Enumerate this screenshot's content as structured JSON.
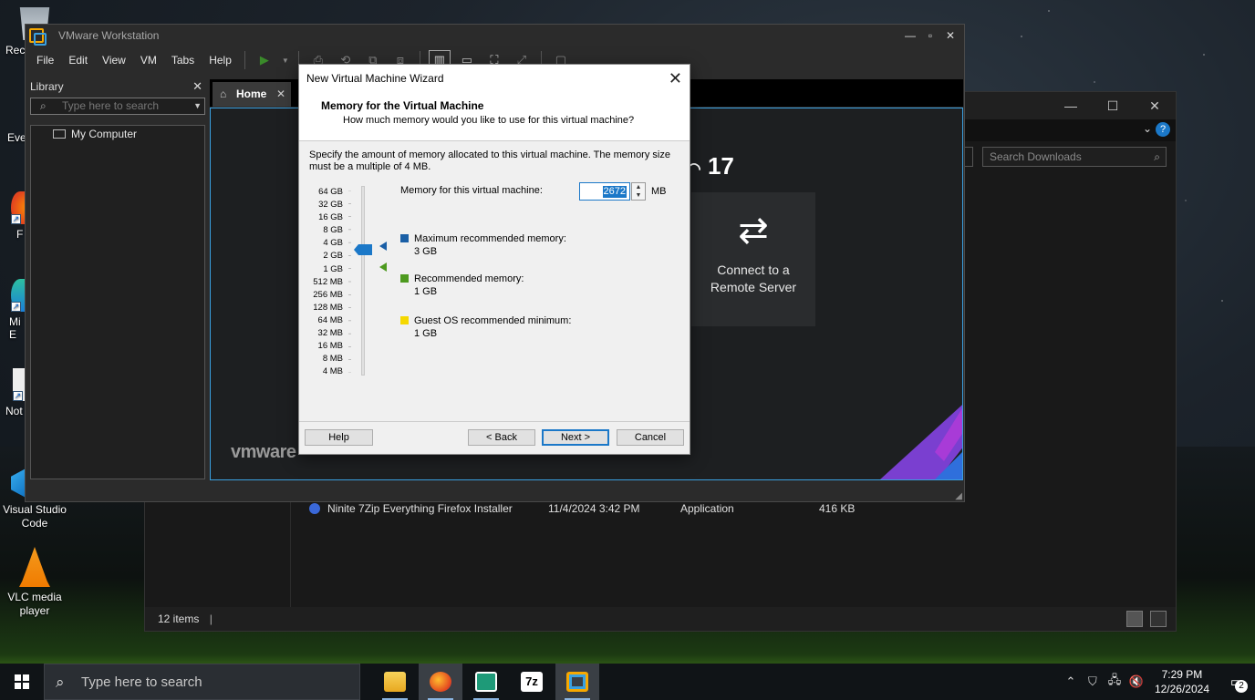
{
  "desktop": {
    "icons": [
      {
        "label": "Rec",
        "icon": "recycle-bin-icon"
      },
      {
        "label": "Eve",
        "icon": "app-shortcut-icon"
      },
      {
        "label": "F",
        "icon": "firefox-icon"
      },
      {
        "label": "Mi\nE",
        "icon": "edge-icon"
      },
      {
        "label": "Not",
        "icon": "notepad-icon"
      },
      {
        "label": "Visual Studio\nCode",
        "icon": "vscode-icon"
      },
      {
        "label": "VLC media\nplayer",
        "icon": "vlc-icon"
      }
    ]
  },
  "explorer": {
    "search_placeholder": "Search Downloads",
    "file_row": {
      "name": "Ninite 7Zip Everything Firefox Installer",
      "date": "11/4/2024 3:42 PM",
      "type": "Application",
      "size": "416 KB"
    },
    "status": "12 items"
  },
  "vmware": {
    "title": "VMware Workstation",
    "menu": [
      "File",
      "Edit",
      "View",
      "VM",
      "Tabs",
      "Help"
    ],
    "library_title": "Library",
    "library_search_placeholder": "Type here to search",
    "tree_item": "My Computer",
    "tab_home": "Home",
    "brand_suffix": "17",
    "connect_card": {
      "line1": "Connect to a",
      "line2": "Remote Server"
    },
    "wordmark": "vmware"
  },
  "wizard": {
    "window_title": "New Virtual Machine Wizard",
    "header_title": "Memory for the Virtual Machine",
    "header_subtitle": "How much memory would you like to use for this virtual machine?",
    "description": "Specify the amount of memory allocated to this virtual machine. The memory size must be a multiple of 4 MB.",
    "scale": [
      "64 GB",
      "32 GB",
      "16 GB",
      "8 GB",
      "4 GB",
      "2 GB",
      "1 GB",
      "512 MB",
      "256 MB",
      "128 MB",
      "64 MB",
      "32 MB",
      "16 MB",
      "8 MB",
      "4 MB"
    ],
    "memory_label": "Memory for this virtual machine:",
    "memory_value": "2672",
    "memory_unit": "MB",
    "max_recommended": {
      "label": "Maximum recommended memory:",
      "value": "3 GB",
      "color": "#1a5fa6"
    },
    "recommended": {
      "label": "Recommended memory:",
      "value": "1 GB",
      "color": "#4d9a1f"
    },
    "guest_min": {
      "label": "Guest OS recommended minimum:",
      "value": "1 GB",
      "color": "#f5d800"
    },
    "buttons": {
      "help": "Help",
      "back": "< Back",
      "next": "Next >",
      "cancel": "Cancel"
    }
  },
  "taskbar": {
    "search_placeholder": "Type here to search",
    "apps": [
      "file-explorer-icon",
      "firefox-icon",
      "remote-app-icon",
      "7zip-icon",
      "vmware-icon"
    ],
    "seven_zip_label": "7z",
    "time": "7:29 PM",
    "date": "12/26/2024",
    "notification_count": "2"
  }
}
